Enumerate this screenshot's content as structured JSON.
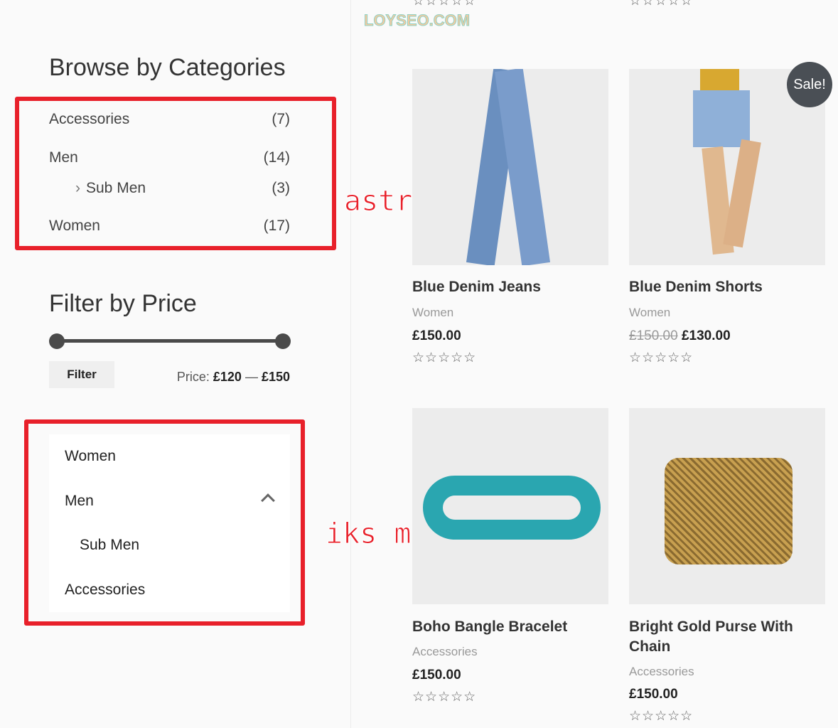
{
  "watermark": "LOYSEO.COM",
  "sidebar": {
    "categories_title": "Browse by Categories",
    "categories": [
      {
        "label": "Accessories",
        "count": "(7)"
      },
      {
        "label": "Men",
        "count": "(14)"
      },
      {
        "label": "Sub Men",
        "count": "(3)"
      },
      {
        "label": "Women",
        "count": "(17)"
      }
    ],
    "price_title": "Filter by Price",
    "price_range": {
      "min": 120,
      "max": 150
    },
    "filter_label": "Filter",
    "price_prefix": "Price:",
    "price_from": "£120",
    "price_sep": "—",
    "price_to": "£150",
    "iks_menu": [
      "Women",
      "Men",
      "Sub Men",
      "Accessories"
    ]
  },
  "annotations": {
    "astra": "astra自带的",
    "iks": "iks menu制作的"
  },
  "products": [
    {
      "title": "Blue Denim Jeans",
      "category": "Women",
      "price": "£150.00",
      "rating": 0
    },
    {
      "title": "Blue Denim Shorts",
      "category": "Women",
      "old_price": "£150.00",
      "price": "£130.00",
      "badge": "Sale!",
      "rating": 0
    },
    {
      "title": "Boho Bangle Bracelet",
      "category": "Accessories",
      "price": "£150.00",
      "rating": 0
    },
    {
      "title": "Bright Gold Purse With Chain",
      "category": "Accessories",
      "price": "£150.00",
      "rating": 0
    }
  ],
  "stars": "☆☆☆☆☆",
  "colors": {
    "annotation": "#e8202a",
    "badge": "#4a4f55"
  }
}
